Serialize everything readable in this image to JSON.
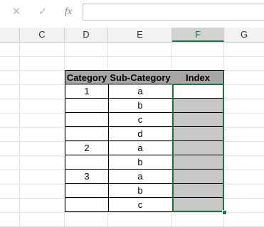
{
  "formula_bar": {
    "cancel_icon": "cancel-icon",
    "confirm_icon": "confirm-icon",
    "fx_label": "fx",
    "value": ""
  },
  "columns": [
    "C",
    "D",
    "E",
    "F",
    "G"
  ],
  "active_column": "F",
  "table": {
    "headers": [
      "Category",
      "Sub-Category",
      "Index"
    ],
    "rows": [
      {
        "category": "1",
        "sub": "a",
        "index": ""
      },
      {
        "category": "",
        "sub": "b",
        "index": ""
      },
      {
        "category": "",
        "sub": "c",
        "index": ""
      },
      {
        "category": "",
        "sub": "d",
        "index": ""
      },
      {
        "category": "2",
        "sub": "a",
        "index": ""
      },
      {
        "category": "",
        "sub": "b",
        "index": ""
      },
      {
        "category": "3",
        "sub": "a",
        "index": ""
      },
      {
        "category": "",
        "sub": "b",
        "index": ""
      },
      {
        "category": "",
        "sub": "c",
        "index": ""
      }
    ]
  },
  "colors": {
    "accent": "#217346",
    "header_fill": "#a6a6a6",
    "selection_fill": "#c8c8c8"
  }
}
